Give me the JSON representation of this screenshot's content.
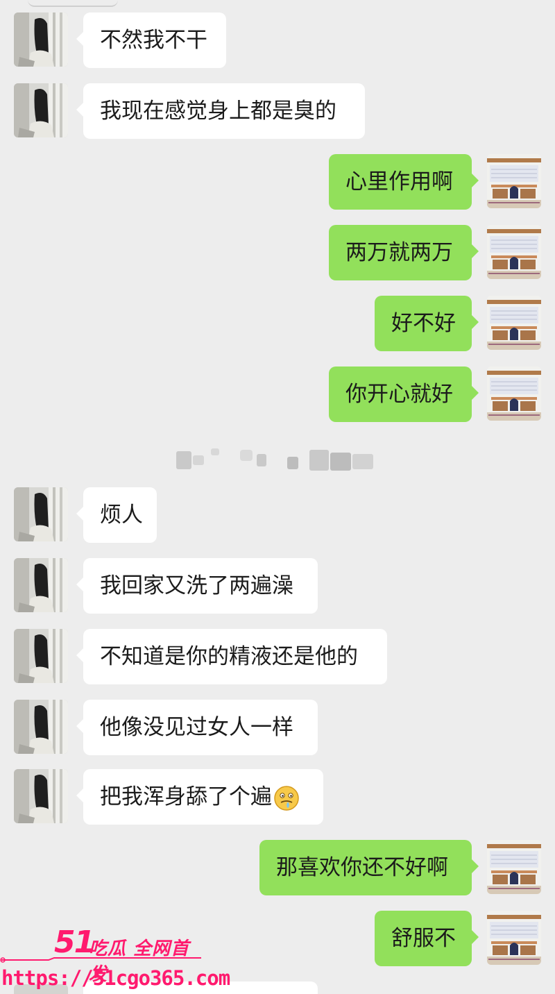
{
  "messages": [
    {
      "side": "left",
      "text": "不然我不干"
    },
    {
      "side": "left",
      "text": "我现在感觉身上都是臭的"
    },
    {
      "side": "right",
      "text": "心里作用啊"
    },
    {
      "side": "right",
      "text": "两万就两万"
    },
    {
      "side": "right",
      "text": "好不好"
    },
    {
      "side": "right",
      "text": "你开心就好"
    },
    {
      "side": "left",
      "text": "烦人"
    },
    {
      "side": "left",
      "text": "我回家又洗了两遍澡"
    },
    {
      "side": "left",
      "text": "不知道是你的精液还是他的"
    },
    {
      "side": "left",
      "text": "他像没见过女人一样"
    },
    {
      "side": "left",
      "text": "把我浑身舔了个遍",
      "emoji": "drooling-face-emoji"
    },
    {
      "side": "right",
      "text": "那喜欢你还不好啊"
    },
    {
      "side": "right",
      "text": "舒服不"
    }
  ],
  "watermark": {
    "logo": "51",
    "tagline": "吃瓜 全网首发",
    "url": "https://51cgo365.com"
  },
  "colors": {
    "background": "#ededed",
    "bubble_left": "#ffffff",
    "bubble_right": "#92e05b",
    "watermark": "#ff1a6e"
  }
}
